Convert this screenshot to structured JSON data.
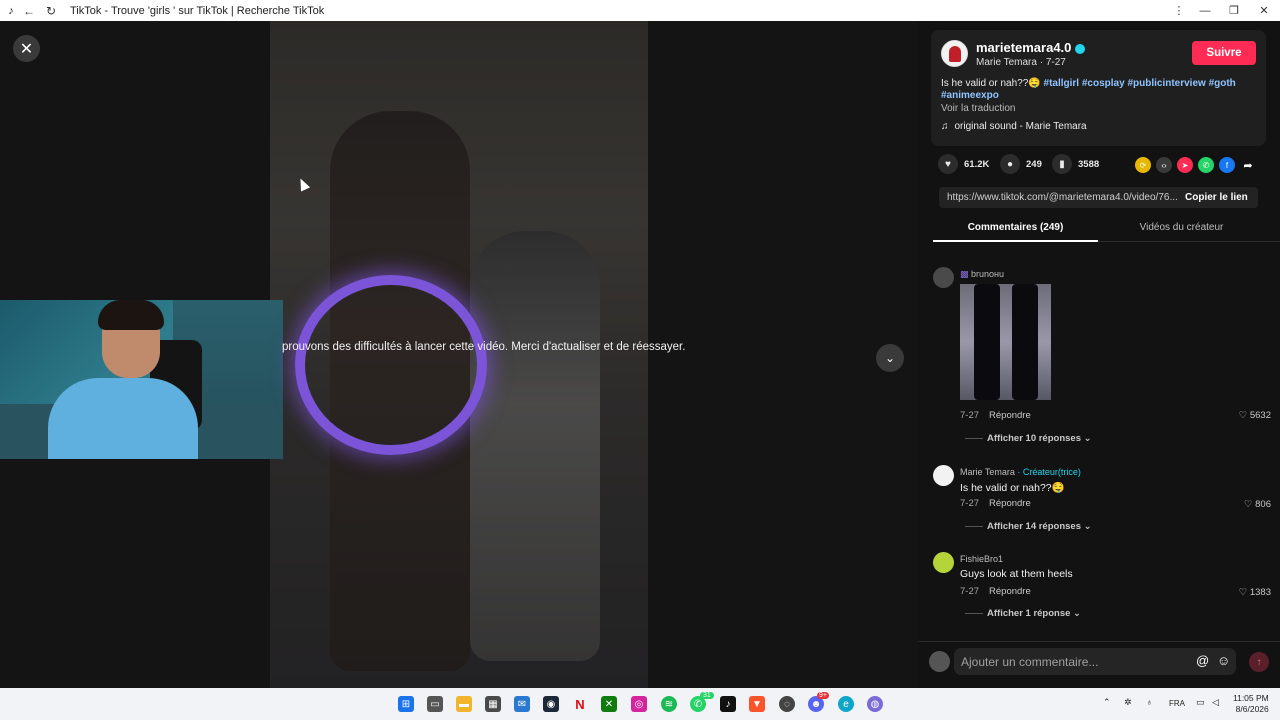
{
  "titlebar": {
    "title": "TikTok - Trouve 'girls ' sur TikTok | Recherche TikTok"
  },
  "video": {
    "error_message": "prouvons des difficultés à lancer cette vidéo. Merci d'actualiser et de réessayer."
  },
  "post": {
    "username": "marietemara4.0",
    "subline": "Marie Temara · 7-27",
    "follow_label": "Suivre",
    "caption_text": "Is he valid or nah??🤤",
    "hashtags_line1": "#tallgirl #cosplay #publicinterview #goth",
    "hashtags_line2": "#animeexpo",
    "translate_label": "Voir la traduction",
    "sound": "original sound - Marie Temara"
  },
  "actions": {
    "likes": "61.2K",
    "comments": "249",
    "saves": "3588"
  },
  "link": {
    "url": "https://www.tiktok.com/@marietemara4.0/video/76...",
    "copy_label": "Copier le lien"
  },
  "tabs": {
    "comments_label": "Commentaires (249)",
    "creator_videos_label": "Vidéos du créateur"
  },
  "comments": [
    {
      "user": "brunoнu",
      "text": "",
      "date": "7-27",
      "reply": "Répondre",
      "likes": "5632",
      "more": "Afficher 10 réponses ⌄"
    },
    {
      "user": "Marie Temara",
      "creator": "· Créateur(trice)",
      "text": "Is he valid or nah??🤤",
      "date": "7-27",
      "reply": "Répondre",
      "likes": "806",
      "more": "Afficher 14 réponses ⌄"
    },
    {
      "user": "FishieBro1",
      "text": "Guys look at them heels",
      "date": "7-27",
      "reply": "Répondre",
      "likes": "1383",
      "more": "Afficher 1 réponse ⌄"
    }
  ],
  "comment_bar": {
    "placeholder": "Ajouter un commentaire..."
  },
  "taskbar": {
    "language": "FRA",
    "time": "11:05 PM",
    "date": "8/6/2026",
    "whatsapp_badge": "31",
    "discord_badge": "9+"
  }
}
